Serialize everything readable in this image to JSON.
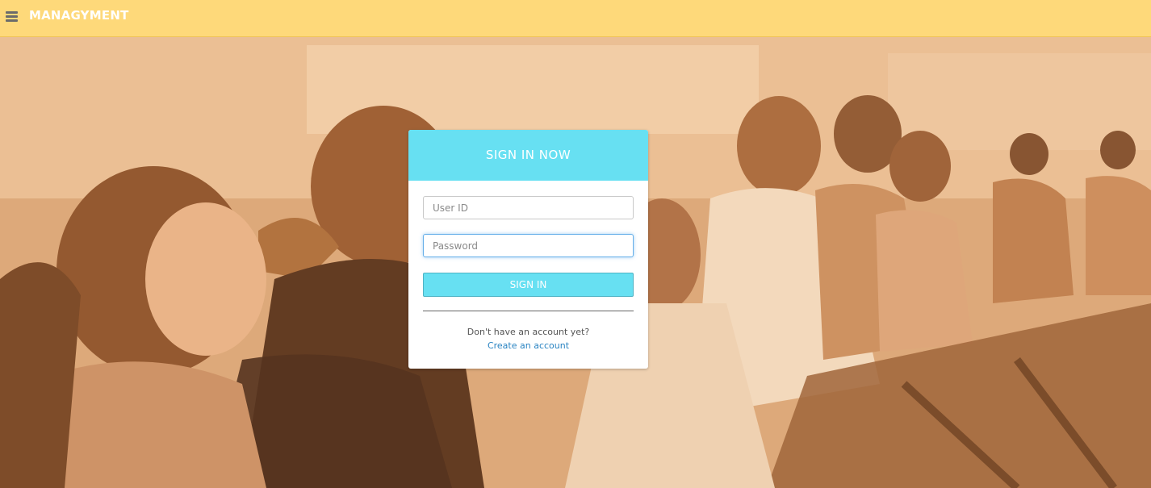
{
  "header": {
    "brand": "MANAGYMENT",
    "menu_icon": "hamburger-menu-icon",
    "background_color": "#fed97a"
  },
  "hero": {
    "description_icon": "gym-spinning-class-photo"
  },
  "login": {
    "title": "SIGN IN NOW",
    "user_id_placeholder": "User ID",
    "password_placeholder": "Password",
    "sign_in_label": "SIGN IN",
    "no_account_text": "Don't have an account yet?",
    "create_account_label": "Create an account",
    "accent_color": "#67e0f2",
    "link_color": "#2a84c2"
  }
}
